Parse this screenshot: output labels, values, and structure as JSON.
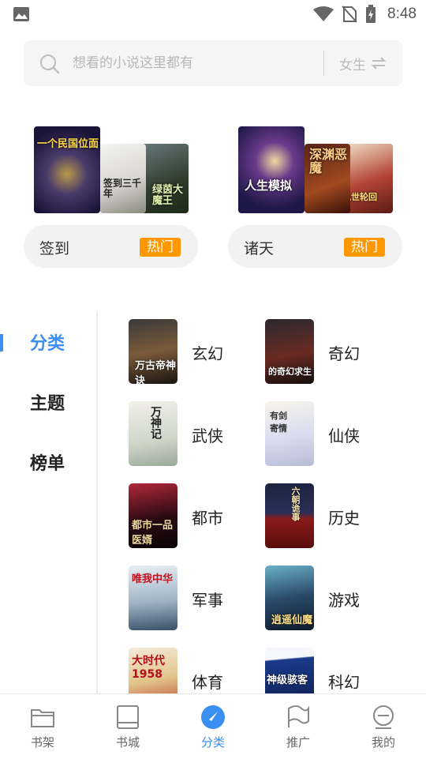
{
  "status_bar": {
    "time": "8:48"
  },
  "search": {
    "placeholder": "想看的小说这里都有",
    "gender": "女生"
  },
  "featured": [
    {
      "label": "签到",
      "badge": "热门",
      "covers": [
        "一个民国位面",
        "签到三千年",
        "绿茵大魔王"
      ]
    },
    {
      "label": "诸天",
      "badge": "热门",
      "covers": [
        "人生模拟",
        "深渊恶魔",
        "九世轮回"
      ]
    }
  ],
  "left_nav": {
    "items": [
      "分类",
      "主题",
      "榜单"
    ],
    "active": "分类"
  },
  "categories": [
    {
      "label": "玄幻",
      "cover_text": "万古帝神诀"
    },
    {
      "label": "奇幻",
      "cover_text": "的奇幻求生"
    },
    {
      "label": "武侠",
      "cover_text": "万神记"
    },
    {
      "label": "仙侠",
      "cover_text": "有剑寄情"
    },
    {
      "label": "都市",
      "cover_text": "都市一品医婿"
    },
    {
      "label": "历史",
      "cover_text": "六朝诡事"
    },
    {
      "label": "军事",
      "cover_text": "唯我中华"
    },
    {
      "label": "游戏",
      "cover_text": "逍遥仙魔"
    },
    {
      "label": "体育",
      "cover_text": "大时代1958"
    },
    {
      "label": "科幻",
      "cover_text": "神级骇客"
    }
  ],
  "bottom_nav": {
    "tabs": [
      "书架",
      "书城",
      "分类",
      "推广",
      "我的"
    ],
    "active": "分类"
  },
  "colors": {
    "accent": "#3b8ff3",
    "hot": "#ff9800"
  }
}
